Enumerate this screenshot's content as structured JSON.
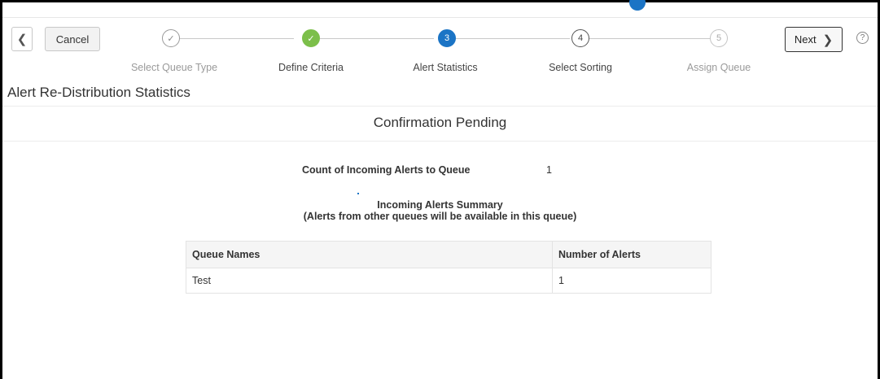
{
  "nav": {
    "back_icon": "chevron-left-icon",
    "cancel_label": "Cancel",
    "next_label": "Next",
    "next_icon": "chevron-right-icon",
    "help_icon": "help-icon",
    "help_glyph": "?"
  },
  "train": {
    "steps": [
      {
        "glyph": "✓",
        "label": "Select Queue Type",
        "state": "visited"
      },
      {
        "glyph": "✓",
        "label": "Define Criteria",
        "state": "done"
      },
      {
        "glyph": "3",
        "label": "Alert Statistics",
        "state": "current"
      },
      {
        "glyph": "4",
        "label": "Select Sorting",
        "state": "next"
      },
      {
        "glyph": "5",
        "label": "Assign Queue",
        "state": "disabled"
      }
    ]
  },
  "page": {
    "title": "Alert Re-Distribution Statistics",
    "confirmation_title": "Confirmation Pending",
    "count_label": "Count of Incoming Alerts to Queue",
    "count_value": "1",
    "summary_title": "Incoming Alerts Summary",
    "summary_subtitle": "(Alerts from other queues will be available in this queue)"
  },
  "table": {
    "headers": [
      "Queue Names",
      "Number of Alerts"
    ],
    "rows": [
      [
        "Test",
        "1"
      ]
    ]
  },
  "colors": {
    "accent": "#1b74c5",
    "done": "#7cbf4a"
  }
}
